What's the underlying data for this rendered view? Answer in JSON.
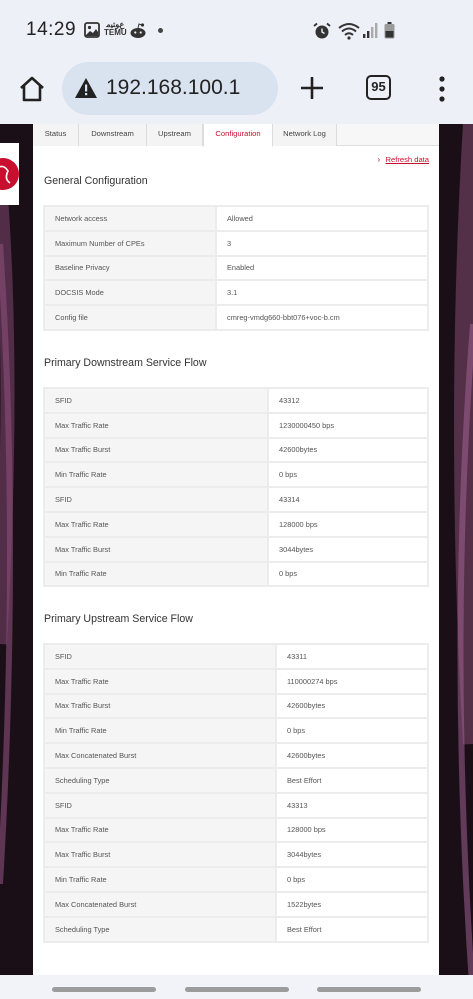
{
  "status_bar": {
    "time": "14:29",
    "temu_top": "ﻉﻮﺘﻴﻣ",
    "temu_bottom": "TEMU",
    "icons": [
      "gallery-icon",
      "temu-icon",
      "reddit-icon",
      "dot-icon",
      "alarm-icon",
      "wifi-icon",
      "signal-icon",
      "battery-icon"
    ]
  },
  "browser": {
    "url": "192.168.100.1",
    "tab_count": "95",
    "icons": [
      "home-icon",
      "warning-icon",
      "plus-icon",
      "tabs-icon",
      "more-vert-icon"
    ]
  },
  "tabs": [
    {
      "label": "Status"
    },
    {
      "label": "Downstream"
    },
    {
      "label": "Upstream"
    },
    {
      "label": "Configuration"
    },
    {
      "label": "Network Log"
    }
  ],
  "refresh_label": "Refresh data",
  "general": {
    "title": "General Configuration",
    "rows": [
      {
        "key": "Network access",
        "value": "Allowed"
      },
      {
        "key": "Maximum Number of CPEs",
        "value": "3"
      },
      {
        "key": "Baseline Privacy",
        "value": "Enabled"
      },
      {
        "key": "DOCSIS Mode",
        "value": "3.1"
      },
      {
        "key": "Config file",
        "value": "cmreg-vmdg660-bbt076+voc-b.cm"
      }
    ]
  },
  "downstream": {
    "title": "Primary Downstream Service Flow",
    "rows": [
      {
        "key": "SFID",
        "value": "43312"
      },
      {
        "key": "Max Traffic Rate",
        "value": "1230000450 bps"
      },
      {
        "key": "Max Traffic Burst",
        "value": "42600bytes"
      },
      {
        "key": "Min Traffic Rate",
        "value": "0 bps"
      },
      {
        "key": "SFID",
        "value": "43314"
      },
      {
        "key": "Max Traffic Rate",
        "value": "128000 bps"
      },
      {
        "key": "Max Traffic Burst",
        "value": "3044bytes"
      },
      {
        "key": "Min Traffic Rate",
        "value": "0 bps"
      }
    ]
  },
  "upstream": {
    "title": "Primary Upstream Service Flow",
    "rows": [
      {
        "key": "SFID",
        "value": "43311"
      },
      {
        "key": "Max Traffic Rate",
        "value": "110000274 bps"
      },
      {
        "key": "Max Traffic Burst",
        "value": "42600bytes"
      },
      {
        "key": "Min Traffic Rate",
        "value": "0 bps"
      },
      {
        "key": "Max Concatenated Burst",
        "value": "42600bytes"
      },
      {
        "key": "Scheduling Type",
        "value": "Best Effort"
      },
      {
        "key": "SFID",
        "value": "43313"
      },
      {
        "key": "Max Traffic Rate",
        "value": "128000 bps"
      },
      {
        "key": "Max Traffic Burst",
        "value": "3044bytes"
      },
      {
        "key": "Min Traffic Rate",
        "value": "0 bps"
      },
      {
        "key": "Max Concatenated Burst",
        "value": "1522bytes"
      },
      {
        "key": "Scheduling Type",
        "value": "Best Effort"
      }
    ]
  },
  "colors": {
    "accent": "#c8102e",
    "page_background": "#1a0f17",
    "url_bar": "#d9e2ef"
  }
}
